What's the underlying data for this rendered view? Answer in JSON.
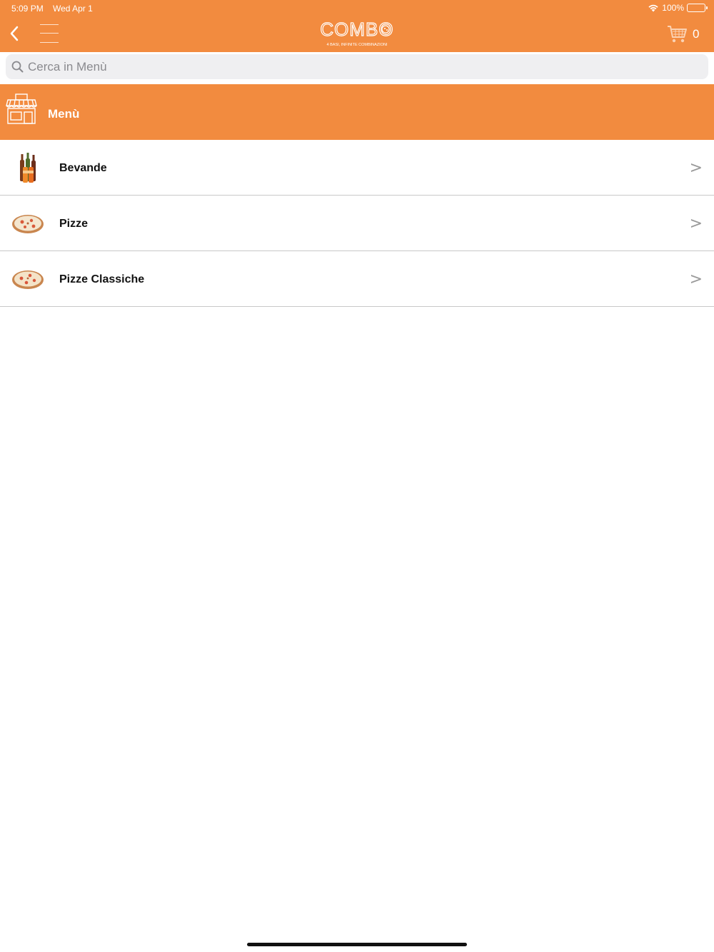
{
  "status_bar": {
    "time": "5:09 PM",
    "date": "Wed Apr 1",
    "battery": "100%",
    "wifi_icon": "wifi-icon",
    "battery_icon": "battery-icon"
  },
  "header": {
    "back_icon": "chevron-left-icon",
    "menu_icon": "hamburger-icon",
    "logo_text": "COMBO",
    "logo_tagline": "4 BASI, INFINITE COMBINAZIONI",
    "cart_icon": "cart-icon",
    "cart_count": "0"
  },
  "search": {
    "placeholder": "Cerca in Menù",
    "value": ""
  },
  "section": {
    "title": "Menù",
    "icon": "store-icon"
  },
  "categories": [
    {
      "label": "Bevande",
      "icon": "drinks-thumbnail"
    },
    {
      "label": "Pizze",
      "icon": "pizza-thumbnail"
    },
    {
      "label": "Pizze Classiche",
      "icon": "pizza-thumbnail"
    }
  ],
  "chevron_glyph": ">",
  "colors": {
    "brand": "#F28B3F",
    "search_bg": "#EFEFF1",
    "divider": "#c8c8c8"
  }
}
